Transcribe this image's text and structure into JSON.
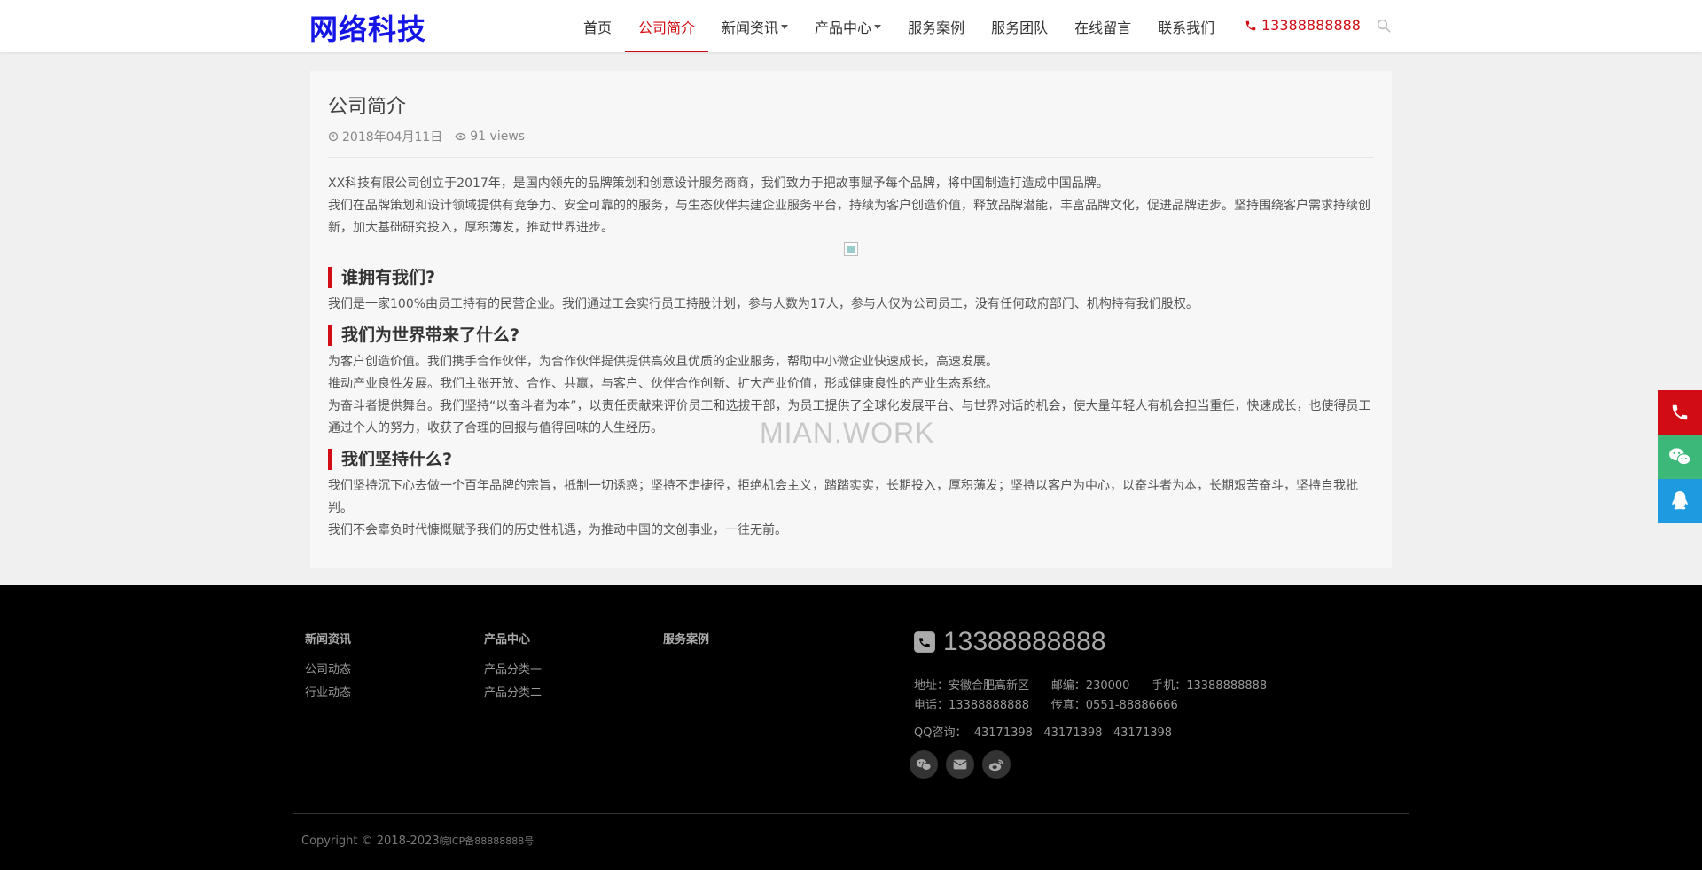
{
  "header": {
    "logo": "网络科技",
    "nav": [
      {
        "label": "首页",
        "active": false,
        "dropdown": false
      },
      {
        "label": "公司简介",
        "active": true,
        "dropdown": false
      },
      {
        "label": "新闻资讯",
        "active": false,
        "dropdown": true
      },
      {
        "label": "产品中心",
        "active": false,
        "dropdown": true
      },
      {
        "label": "服务案例",
        "active": false,
        "dropdown": false
      },
      {
        "label": "服务团队",
        "active": false,
        "dropdown": false
      },
      {
        "label": "在线留言",
        "active": false,
        "dropdown": false
      },
      {
        "label": "联系我们",
        "active": false,
        "dropdown": false
      }
    ],
    "phone": "13388888888",
    "accent_color": "#d10c14",
    "logo_color": "#1515e6"
  },
  "article": {
    "title": "公司简介",
    "date": "2018年04月11日",
    "views": "91 views",
    "intro": [
      "XX科技有限公司创立于2017年，是国内领先的品牌策划和创意设计服务商商，我们致力于把故事赋予每个品牌，将中国制造打造成中国品牌。",
      "我们在品牌策划和设计领域提供有竞争力、安全可靠的的服务，与生态伙伴共建企业服务平台，持续为客户创造价值，释放品牌潜能，丰富品牌文化，促进品牌进步。坚持围绕客户需求持续创新，加大基础研究投入，厚积薄发，推动世界进步。"
    ],
    "sections": [
      {
        "heading": "谁拥有我们?",
        "paragraphs": [
          "我们是一家100%由员工持有的民营企业。我们通过工会实行员工持股计划，参与人数为17人，参与人仅为公司员工，没有任何政府部门、机构持有我们股权。"
        ]
      },
      {
        "heading": "我们为世界带来了什么?",
        "paragraphs": [
          "为客户创造价值。我们携手合作伙伴，为合作伙伴提供提供高效且优质的企业服务，帮助中小微企业快速成长，高速发展。",
          "推动产业良性发展。我们主张开放、合作、共赢，与客户、伙伴合作创新、扩大产业价值，形成健康良性的产业生态系统。",
          "为奋斗者提供舞台。我们坚持“以奋斗者为本”，以责任贡献来评价员工和选拔干部，为员工提供了全球化发展平台、与世界对话的机会，使大量年轻人有机会担当重任，快速成长，也使得员工通过个人的努力，收获了合理的回报与值得回味的人生经历。"
        ]
      },
      {
        "heading": "我们坚持什么?",
        "paragraphs": [
          "我们坚持沉下心去做一个百年品牌的宗旨，抵制一切诱惑；坚持不走捷径，拒绝机会主义，踏踏实实，长期投入，厚积薄发；坚持以客户为中心，以奋斗者为本，长期艰苦奋斗，坚持自我批判。",
          "我们不会辜负时代慷慨赋予我们的历史性机遇，为推动中国的文创事业，一往无前。"
        ]
      }
    ],
    "watermark": "MIAN.WORK"
  },
  "side_buttons": [
    {
      "icon": "phone-icon",
      "color": "#d10c14"
    },
    {
      "icon": "wechat-icon",
      "color": "#3cb878"
    },
    {
      "icon": "qq-icon",
      "color": "#1e9ae0"
    }
  ],
  "footer": {
    "columns": [
      {
        "title": "新闻资讯",
        "links": [
          "公司动态",
          "行业动态"
        ]
      },
      {
        "title": "产品中心",
        "links": [
          "产品分类一",
          "产品分类二"
        ]
      },
      {
        "title": "服务案例",
        "links": []
      }
    ],
    "phone": "13388888888",
    "address_line": "地址：安徽合肥高新区      邮编：230000      手机：13388888888",
    "tel_line": "电话：13388888888      传真：0551-88886666",
    "qq_line": "QQ咨询：  43171398   43171398   43171398",
    "social": [
      "wechat-icon",
      "email-icon",
      "weibo-icon"
    ],
    "copyright": "Copyright © 2018-2023",
    "icp": "皖ICP备88888888号"
  }
}
